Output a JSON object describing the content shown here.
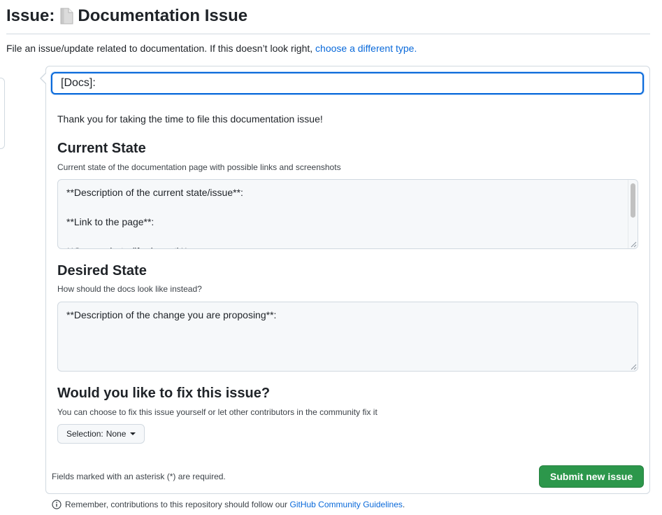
{
  "header": {
    "title_prefix": "Issue:",
    "title": "Documentation Issue",
    "icon": "document-icon"
  },
  "description": {
    "text": "File an issue/update related to documentation. If this doesn’t look right,",
    "link": "choose a different type."
  },
  "form": {
    "title_value": "[Docs]:",
    "intro": "Thank you for taking the time to file this documentation issue!",
    "current_state": {
      "title": "Current State",
      "description": "Current state of the documentation page with possible links and screenshots",
      "value": "**Description of the current state/issue**:\n\n**Link to the page**:\n\n**Screenshots (if relevant)**:"
    },
    "desired_state": {
      "title": "Desired State",
      "description": "How should the docs look like instead?",
      "value": "**Description of the change you are proposing**:"
    },
    "fix_issue": {
      "title": "Would you like to fix this issue?",
      "description": "You can choose to fix this issue yourself or let other contributors in the community fix it",
      "selection_label": "Selection:",
      "selection_value": "None"
    },
    "required_note": "Fields marked with an asterisk (*) are required.",
    "submit_label": "Submit new issue"
  },
  "footer": {
    "text": "Remember, contributions to this repository should follow our",
    "link": "GitHub Community Guidelines",
    "suffix": "."
  },
  "colors": {
    "link": "#0969da",
    "submit": "#2c974b",
    "border": "#d1d9e0",
    "focus": "#0969da"
  }
}
